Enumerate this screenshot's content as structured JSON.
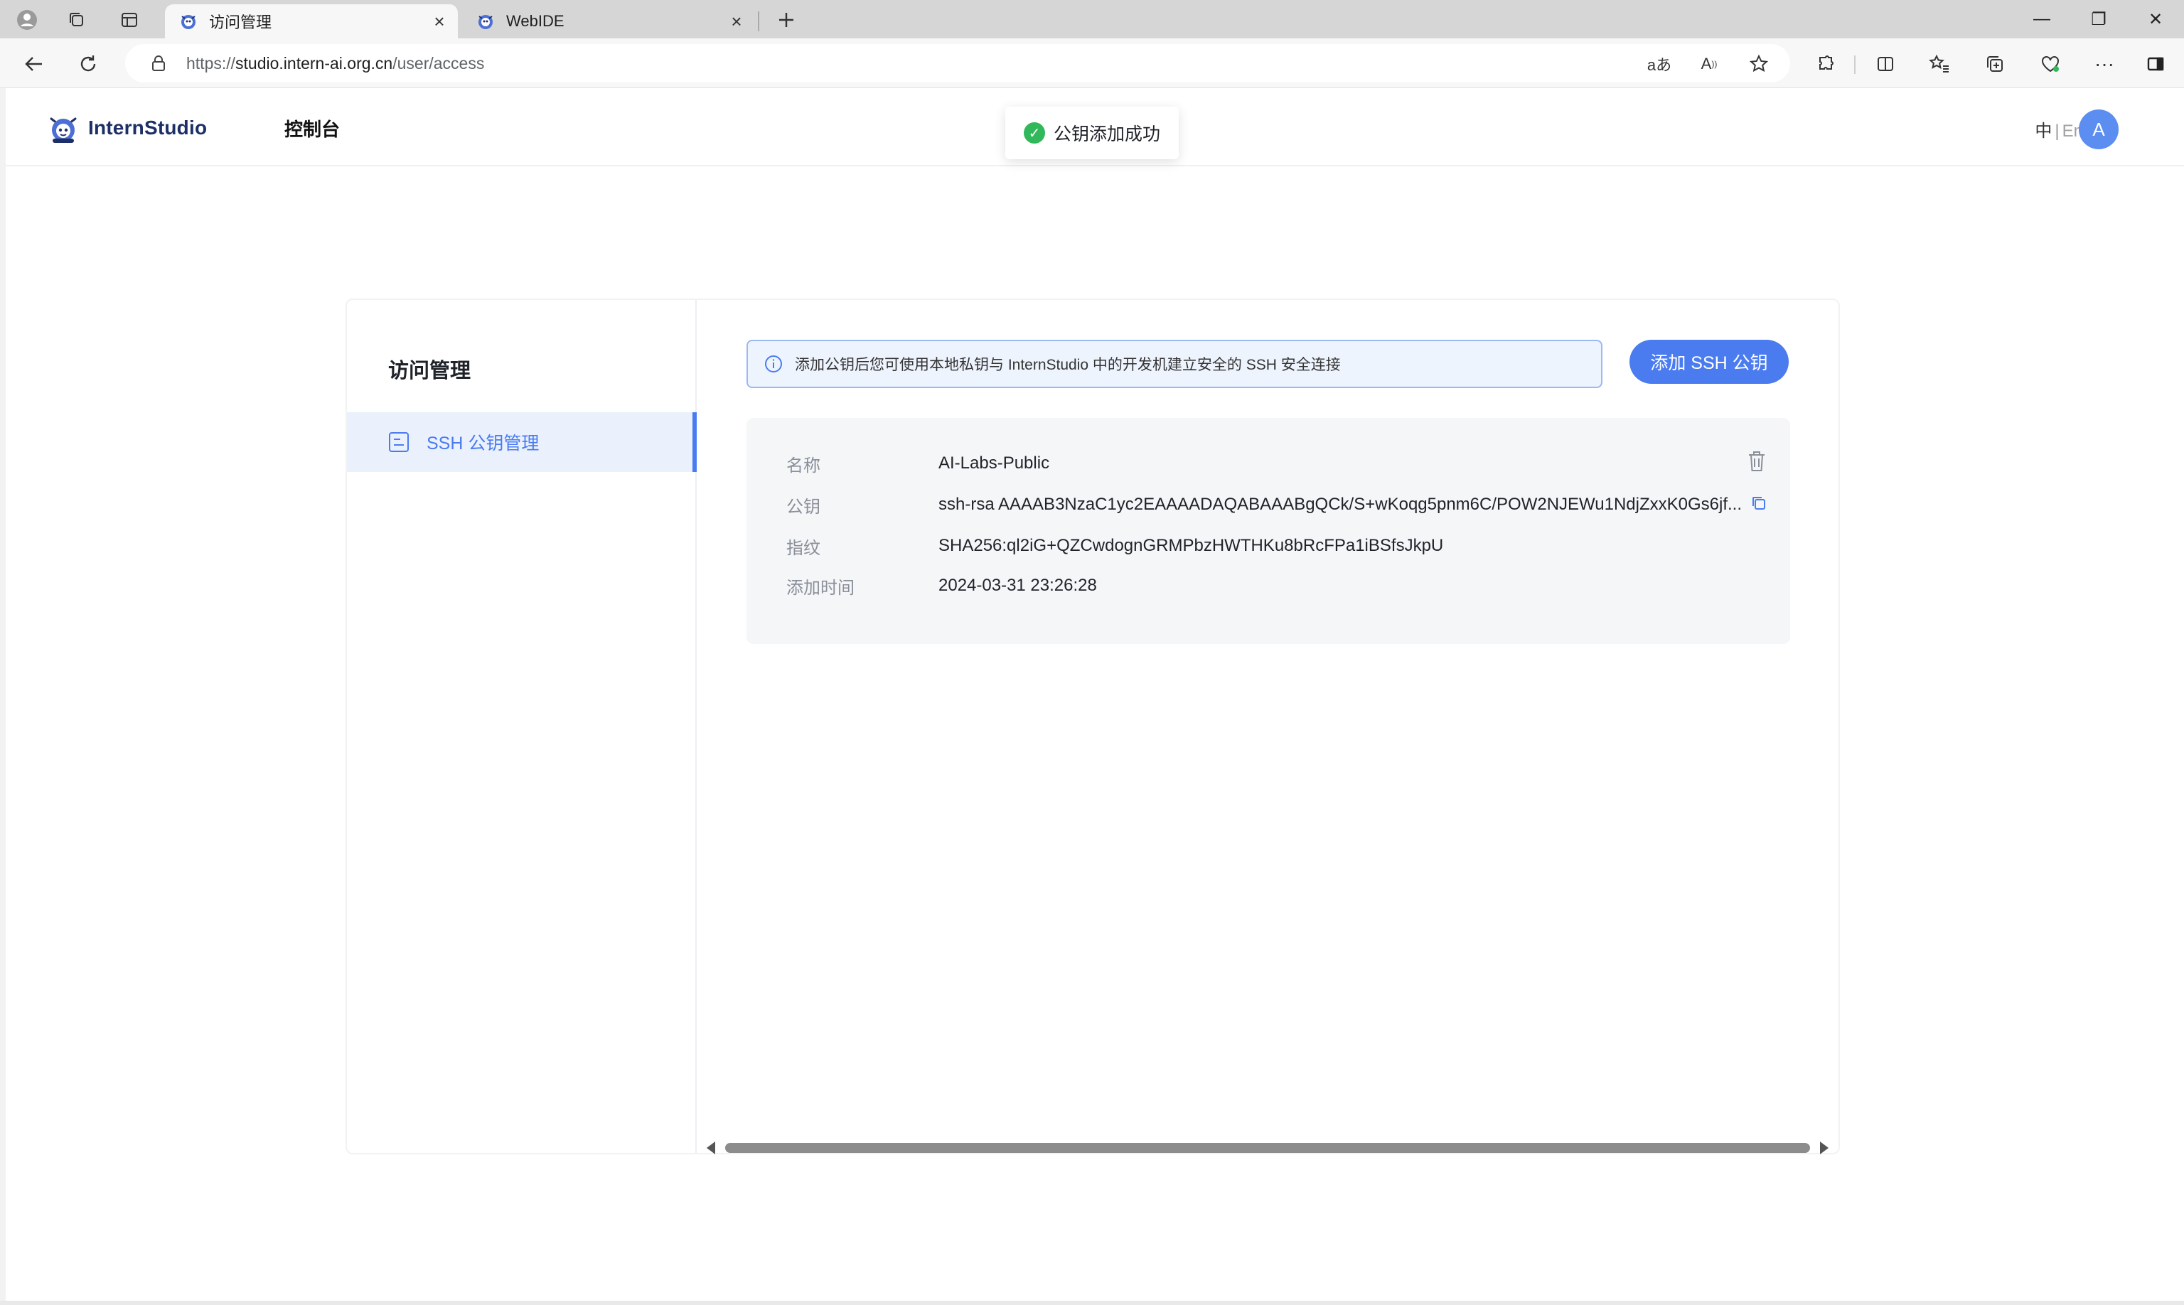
{
  "browser": {
    "tabs": [
      {
        "title": "访问管理",
        "active": true
      },
      {
        "title": "WebIDE",
        "active": false
      }
    ],
    "url_prefix": "https://",
    "url_host": "studio.intern-ai.org.cn",
    "url_path": "/user/access",
    "window_controls": {
      "minimize": "—",
      "restore": "❐",
      "close": "✕"
    }
  },
  "header": {
    "logo_text": "InternStudio",
    "console_label": "控制台",
    "lang_active": "中",
    "lang_separator": "|",
    "lang_inactive": "En",
    "avatar_letter": "A"
  },
  "toast": {
    "message": "公钥添加成功",
    "icon": "check-circle-icon"
  },
  "sidebar": {
    "title": "访问管理",
    "items": [
      {
        "label": "SSH 公钥管理",
        "icon": "document-icon",
        "active": true
      }
    ]
  },
  "main": {
    "info_text": "添加公钥后您可使用本地私钥与 InternStudio 中的开发机建立安全的 SSH 安全连接",
    "add_button_label": "添加 SSH 公钥",
    "key": {
      "name_label": "名称",
      "name_value": "AI-Labs-Public",
      "pubkey_label": "公钥",
      "pubkey_value": "ssh-rsa AAAAB3NzaC1yc2EAAAADAQABAAABgQCk/S+wKoqg5pnm6C/POW2NJEWu1NdjZxxK0Gs6jf...",
      "fingerprint_label": "指纹",
      "fingerprint_value": "SHA256:ql2iG+QZCwdognGRMPbzHWTHKu8bRcFPa1iBSfsJkpU",
      "added_label": "添加时间",
      "added_value": "2024-03-31 23:26:28"
    }
  },
  "colors": {
    "accent": "#4a7cf0",
    "success": "#31b85a",
    "info_bg": "#eef4fe",
    "panel_bg": "#f5f6f8"
  }
}
